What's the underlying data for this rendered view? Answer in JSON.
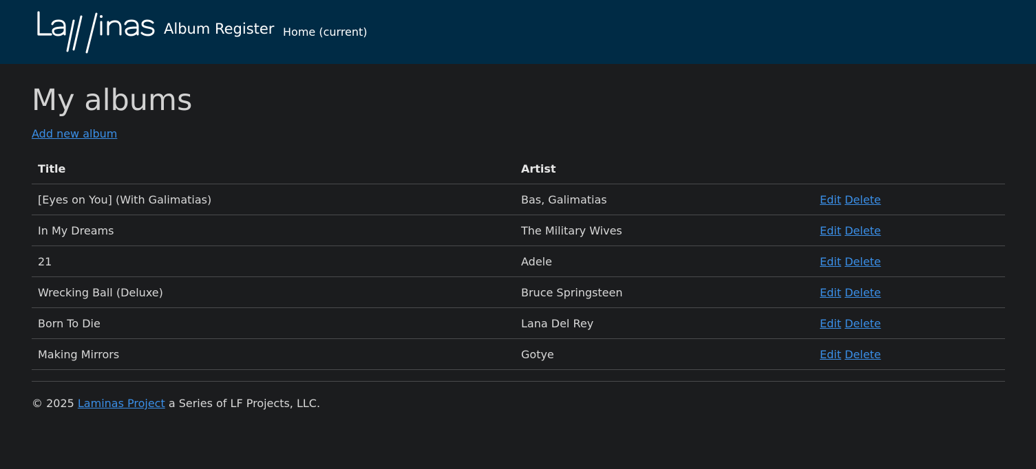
{
  "navbar": {
    "logo_text": "Laminas",
    "brand": "Album Register",
    "home_label": "Home (current)"
  },
  "main": {
    "title": "My albums",
    "add_label": "Add new album",
    "table": {
      "headers": [
        "Title",
        "Artist",
        ""
      ],
      "rows": [
        {
          "title": "[Eyes on You] (With Galimatias)",
          "artist": "Bas, Galimatias",
          "edit": "Edit",
          "delete": "Delete"
        },
        {
          "title": "In My Dreams",
          "artist": "The Military Wives",
          "edit": "Edit",
          "delete": "Delete"
        },
        {
          "title": "21",
          "artist": "Adele",
          "edit": "Edit",
          "delete": "Delete"
        },
        {
          "title": "Wrecking Ball (Deluxe)",
          "artist": "Bruce Springsteen",
          "edit": "Edit",
          "delete": "Delete"
        },
        {
          "title": "Born To Die",
          "artist": "Lana Del Rey",
          "edit": "Edit",
          "delete": "Delete"
        },
        {
          "title": "Making Mirrors",
          "artist": "Gotye",
          "edit": "Edit",
          "delete": "Delete"
        }
      ]
    }
  },
  "footer": {
    "prefix": "© 2025 ",
    "link": "Laminas Project",
    "suffix": " a Series of LF Projects, LLC."
  },
  "colors": {
    "navbar": "#002b45",
    "background": "#1b1c1e",
    "link": "#3a8fe8"
  }
}
